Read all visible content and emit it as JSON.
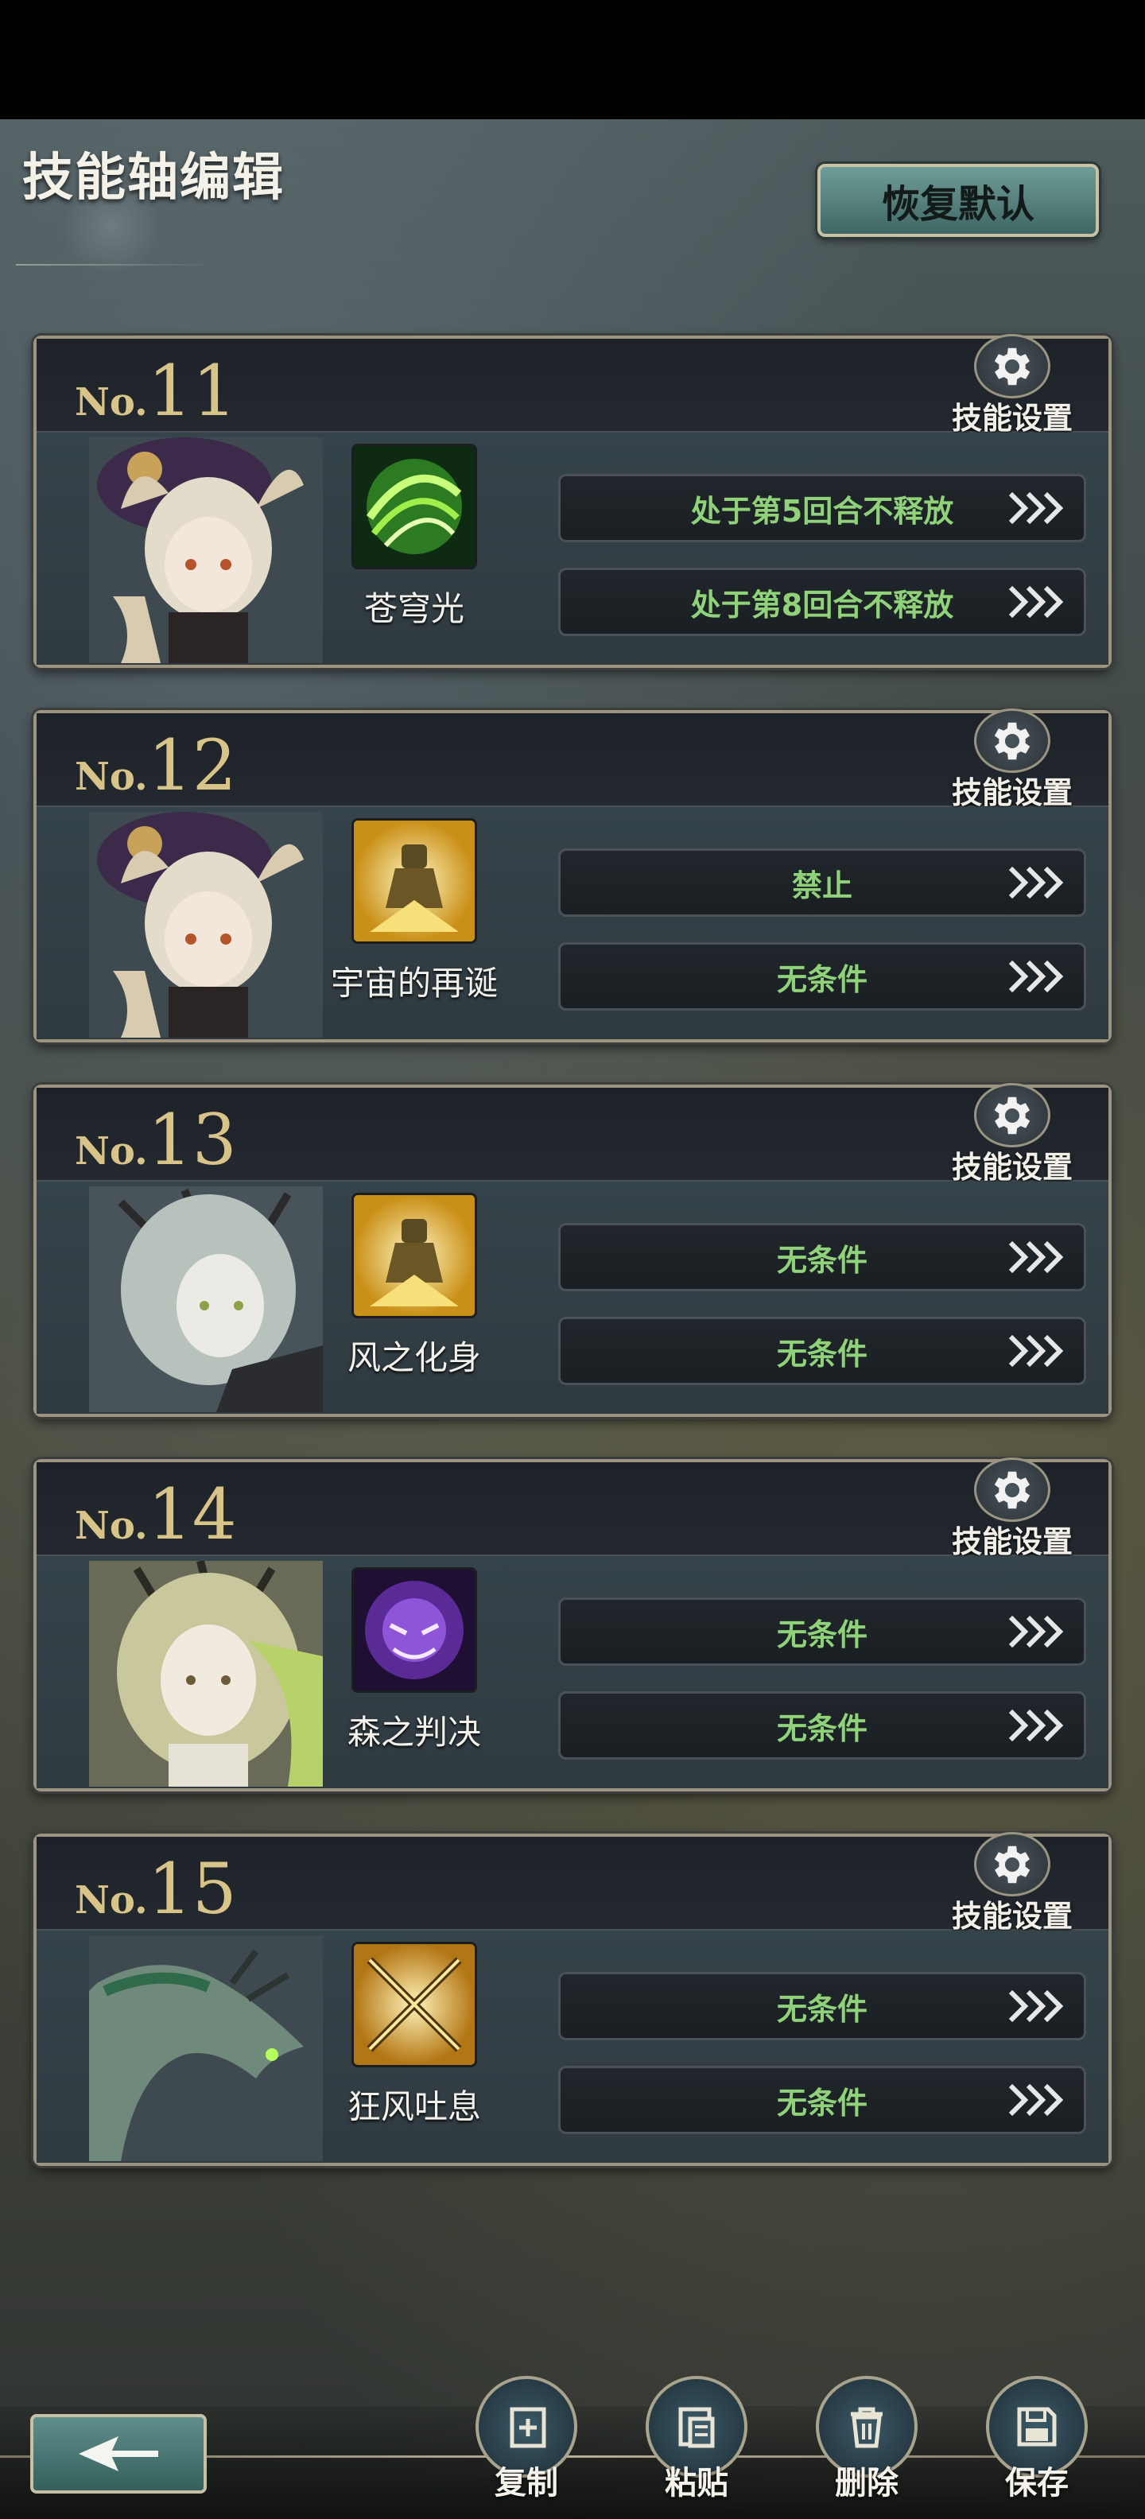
{
  "header": {
    "title": "技能轴编辑",
    "restore_label": "恢复默认"
  },
  "cards": [
    {
      "no_prefix": "No.",
      "number": "11",
      "settings_label": "技能设置",
      "skill_name": "苍穹光",
      "skill_icon": "green-swirl-icon",
      "conditions": [
        "处于第5回合不释放",
        "处于第8回合不释放"
      ]
    },
    {
      "no_prefix": "No.",
      "number": "12",
      "settings_label": "技能设置",
      "skill_name": "宇宙的再诞",
      "skill_icon": "golden-knight-icon",
      "conditions": [
        "禁止",
        "无条件"
      ]
    },
    {
      "no_prefix": "No.",
      "number": "13",
      "settings_label": "技能设置",
      "skill_name": "风之化身",
      "skill_icon": "golden-knight-icon",
      "conditions": [
        "无条件",
        "无条件"
      ]
    },
    {
      "no_prefix": "No.",
      "number": "14",
      "settings_label": "技能设置",
      "skill_name": "森之判决",
      "skill_icon": "purple-beast-icon",
      "conditions": [
        "无条件",
        "无条件"
      ]
    },
    {
      "no_prefix": "No.",
      "number": "15",
      "settings_label": "技能设置",
      "skill_name": "狂风吐息",
      "skill_icon": "crossed-swords-icon",
      "conditions": [
        "无条件",
        "无条件"
      ]
    }
  ],
  "toolbar": {
    "copy_label": "复制",
    "paste_label": "粘贴",
    "delete_label": "删除",
    "save_label": "保存"
  },
  "colors": {
    "accent_gold": "#d8c389",
    "condition_green": "#8fd27a",
    "button_teal": "#5f8f8b"
  }
}
